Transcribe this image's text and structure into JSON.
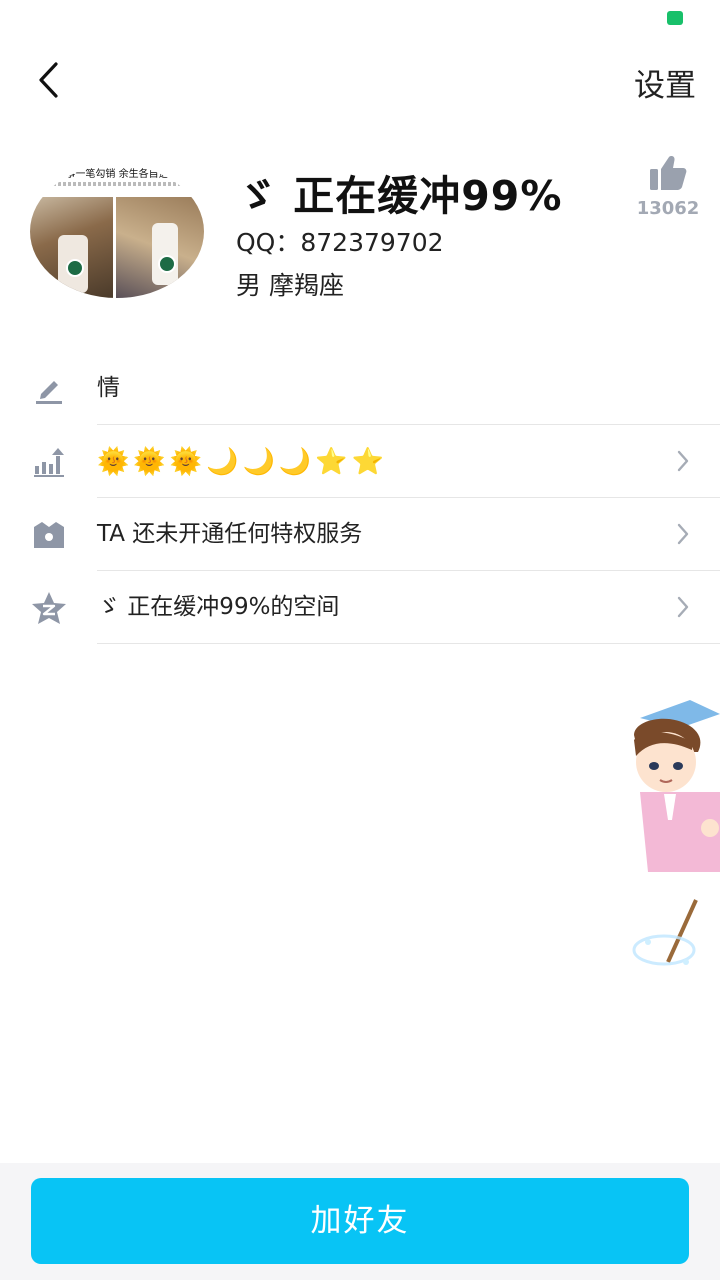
{
  "nav": {
    "settings_label": "设置"
  },
  "profile": {
    "name": "ゞ 正在缓冲99%",
    "qq": "QQ：872379702",
    "gender_sign": "男  摩羯座",
    "likes": "13062",
    "avatar_caption": "往事一笔勾销 余生各自逍遥"
  },
  "rows": [
    {
      "icon": "pencil-icon",
      "text": "情",
      "chevron": false
    },
    {
      "icon": "level-icon",
      "emblems": [
        "🌞",
        "🌞",
        "🌞",
        "🌙",
        "🌙",
        "🌙",
        "⭐",
        "⭐"
      ],
      "chevron": true
    },
    {
      "icon": "crown-icon",
      "text": "TA 还未开通任何特权服务",
      "chevron": true
    },
    {
      "icon": "qzone-star-icon",
      "text": "ゞ 正在缓冲99%的空间",
      "chevron": true
    }
  ],
  "footer": {
    "add_friend_label": "加好友"
  },
  "colors": {
    "accent": "#08c4f5",
    "icon_gray": "#8e96a6",
    "status_green": "#18c06a"
  }
}
